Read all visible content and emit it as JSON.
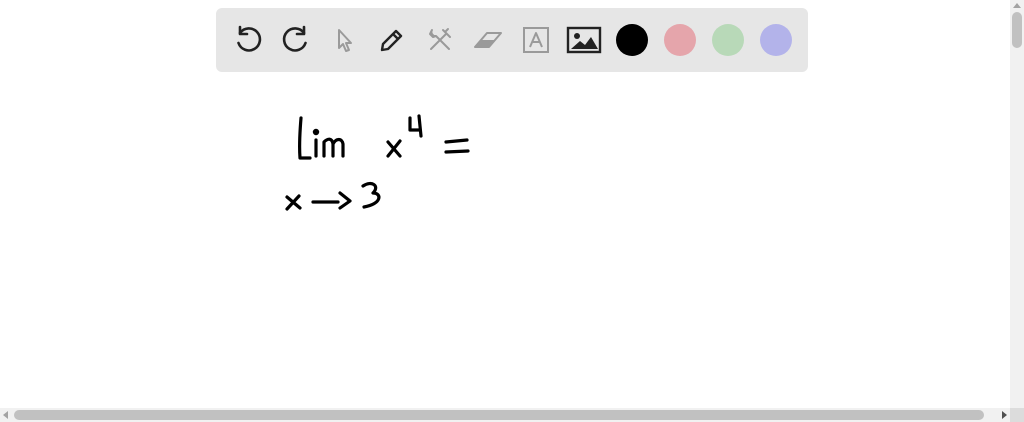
{
  "toolbar": {
    "tools": [
      {
        "name": "undo",
        "icon": "undo-icon",
        "enabled": true
      },
      {
        "name": "redo",
        "icon": "redo-icon",
        "enabled": true
      },
      {
        "name": "select",
        "icon": "pointer-icon",
        "enabled": false
      },
      {
        "name": "pen",
        "icon": "pencil-icon",
        "enabled": true
      },
      {
        "name": "tools",
        "icon": "tools-icon",
        "enabled": false
      },
      {
        "name": "eraser",
        "icon": "eraser-icon",
        "enabled": false
      },
      {
        "name": "text",
        "icon": "text-box-icon",
        "enabled": false
      },
      {
        "name": "image",
        "icon": "image-icon",
        "enabled": true
      }
    ],
    "colors": [
      {
        "name": "black",
        "hex": "#000000",
        "selected": true
      },
      {
        "name": "red",
        "hex": "#e5a5ab"
      },
      {
        "name": "green",
        "hex": "#b8d9b8"
      },
      {
        "name": "blue",
        "hex": "#b3b3ea"
      }
    ]
  },
  "canvas": {
    "ink_color": "#000000"
  }
}
